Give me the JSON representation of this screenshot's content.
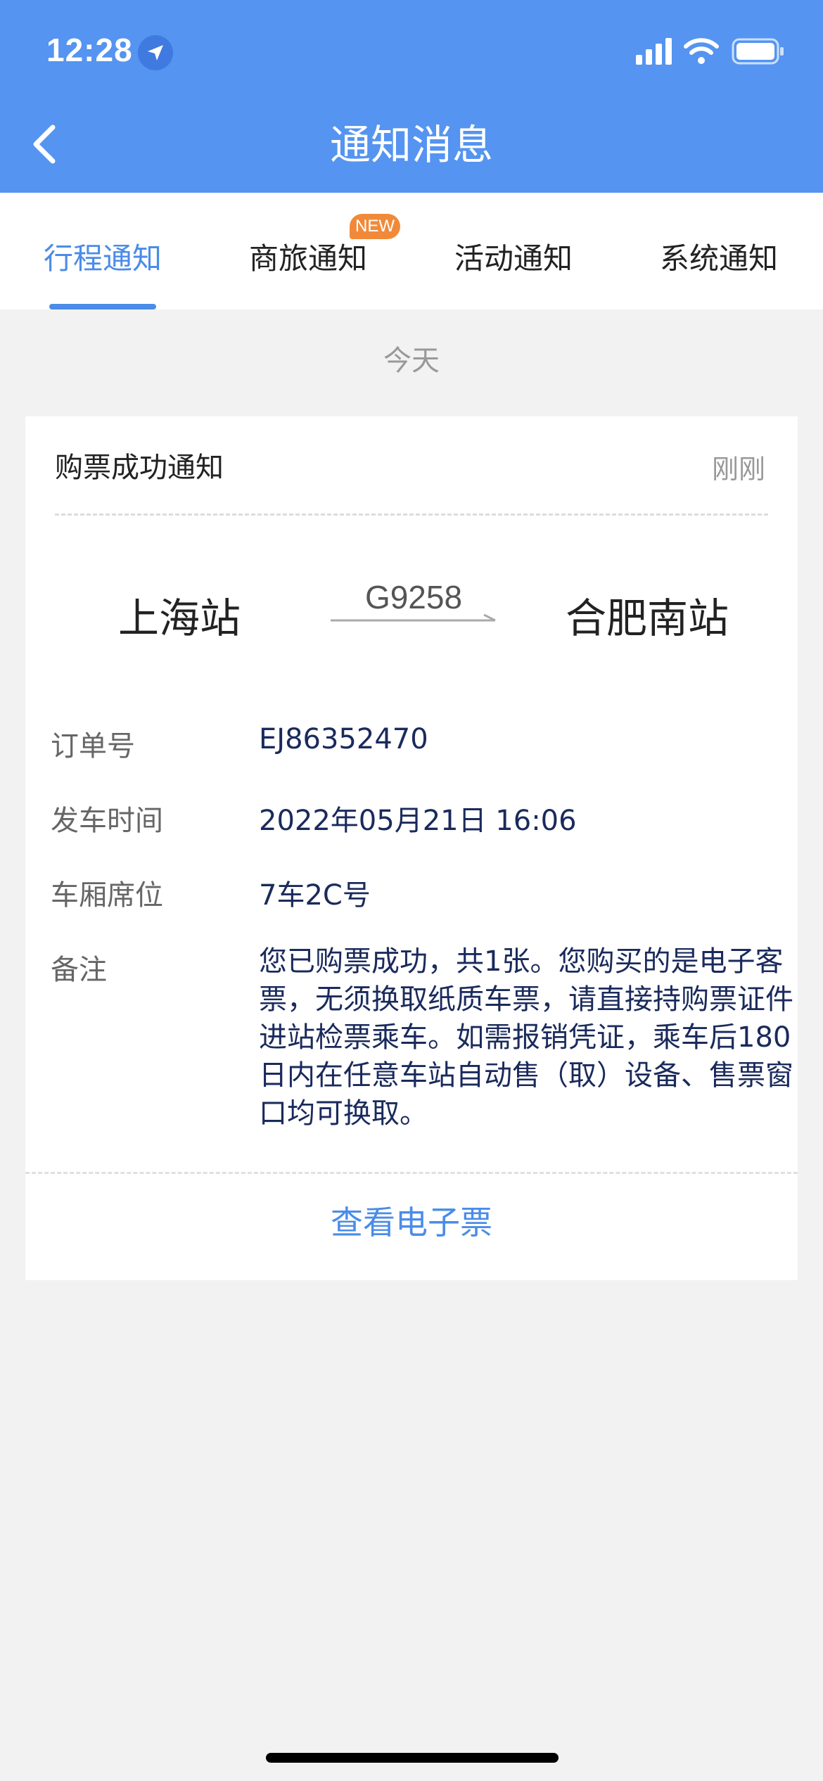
{
  "status_bar": {
    "time": "12:28"
  },
  "nav": {
    "title": "通知消息"
  },
  "tabs": [
    {
      "label": "行程通知",
      "active": true
    },
    {
      "label": "商旅通知",
      "badge": "NEW"
    },
    {
      "label": "活动通知"
    },
    {
      "label": "系统通知"
    }
  ],
  "date_group": "今天",
  "card": {
    "title": "购票成功通知",
    "time": "刚刚",
    "from_station": "上海站",
    "to_station": "合肥南站",
    "train_no": "G9258",
    "order_label": "订单号",
    "order_value": "EJ86352470",
    "depart_label": "发车时间",
    "depart_value": "2022年05月21日 16:06",
    "seat_label": "车厢席位",
    "seat_value": "7车2C号",
    "note_label": "备注",
    "note_value": "您已购票成功，共1张。您购买的是电子客票，无须换取纸质车票，请直接持购票证件进站检票乘车。如需报销凭证，乘车后180日内在任意车站自动售（取）设备、售票窗口均可换取。",
    "view_ticket": "查看电子票"
  },
  "colors": {
    "header": "#5594f0",
    "accent": "#4a8ce8",
    "badge": "#f08a3a"
  }
}
